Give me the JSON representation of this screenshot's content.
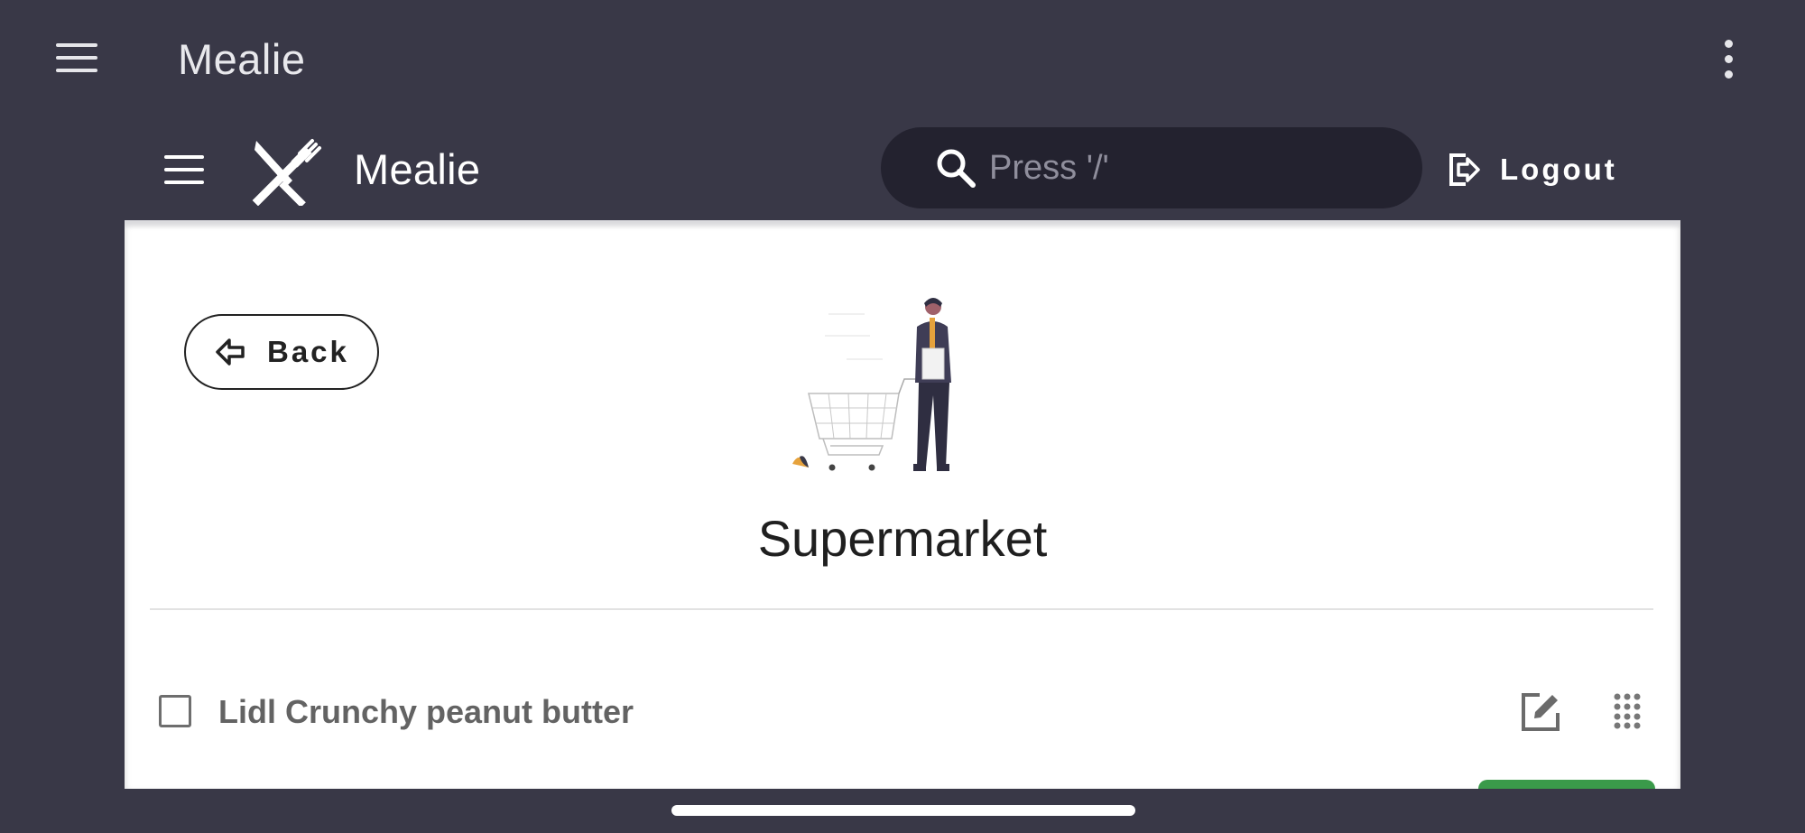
{
  "app_bar": {
    "title": "Mealie"
  },
  "header": {
    "brand": "Mealie",
    "search_placeholder": "Press '/'",
    "logout_label": "Logout"
  },
  "page": {
    "back_label": "Back",
    "title": "Supermarket"
  },
  "items": [
    {
      "label": "Lidl Crunchy peanut butter",
      "checked": false
    }
  ],
  "colors": {
    "background": "#393847",
    "search_bg": "#23222f",
    "card_bg": "#ffffff",
    "accent_green": "#3a9a4a"
  }
}
